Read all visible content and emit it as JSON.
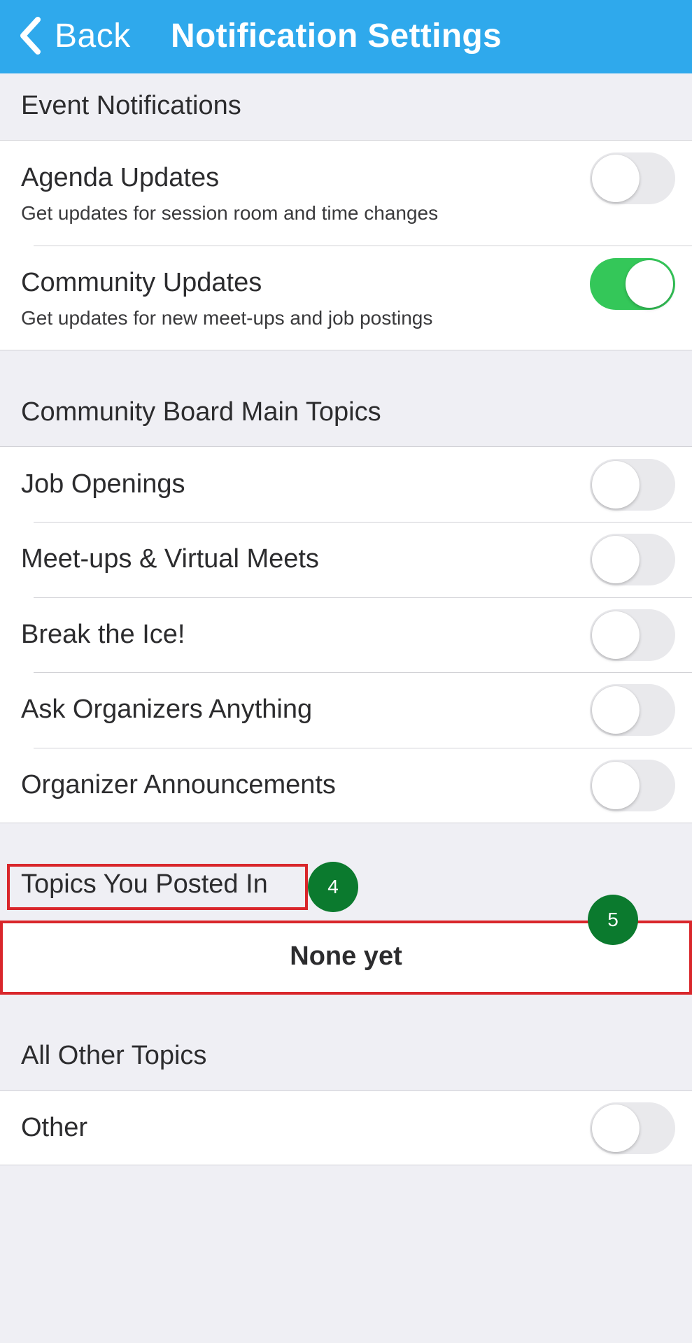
{
  "navbar": {
    "back_label": "Back",
    "title": "Notification Settings",
    "background_color": "#2fa9ec"
  },
  "event_notifications": {
    "header": "Event Notifications",
    "rows": [
      {
        "title": "Agenda Updates",
        "subtitle": "Get updates for session room and time changes",
        "enabled": false
      },
      {
        "title": "Community Updates",
        "subtitle": "Get updates for new meet-ups and job postings",
        "enabled": true
      }
    ]
  },
  "main_topics": {
    "header": "Community Board Main Topics",
    "rows": [
      {
        "title": "Job Openings",
        "enabled": false
      },
      {
        "title": "Meet-ups & Virtual Meets",
        "enabled": false
      },
      {
        "title": "Break the Ice!",
        "enabled": false
      },
      {
        "title": "Ask Organizers Anything",
        "enabled": false
      },
      {
        "title": "Organizer Announcements",
        "enabled": false
      }
    ]
  },
  "posted_topics": {
    "header": "Topics You Posted In",
    "empty_text": "None yet"
  },
  "other_topics": {
    "header": "All Other Topics",
    "rows": [
      {
        "title": "Other",
        "enabled": false
      }
    ]
  },
  "annotations": {
    "badge_4": "4",
    "badge_5": "5"
  },
  "colors": {
    "toggle_on": "#34c759",
    "toggle_off": "#e9e9ec",
    "highlight": "#d9262b",
    "badge": "#0b7a2e"
  }
}
